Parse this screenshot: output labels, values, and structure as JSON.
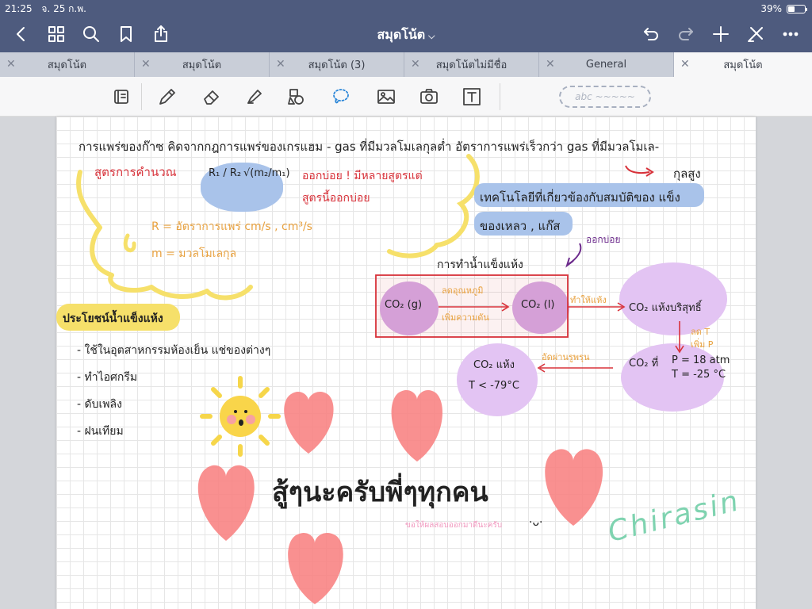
{
  "status": {
    "time": "21:25",
    "date": "จ. 25 ก.พ.",
    "battery_text": "39%",
    "battery_level": 0.39
  },
  "nav": {
    "title": "สมุดโน้ต",
    "icons": [
      "back-icon",
      "grid-icon",
      "search-icon",
      "bookmark-icon",
      "share-icon",
      "undo-icon",
      "redo-icon",
      "add-icon",
      "eraser-toggle-icon",
      "more-icon"
    ]
  },
  "tabs": [
    {
      "label": "สมุดโน้ต"
    },
    {
      "label": "สมุดโน้ต"
    },
    {
      "label": "สมุดโน้ต (3)"
    },
    {
      "label": "สมุดโน้ตไม่มีชื่อ"
    },
    {
      "label": "General"
    },
    {
      "label": "สมุดโน้ต",
      "active": true
    }
  ],
  "toolbar": {
    "tools": [
      "page-toggle-icon",
      "pen-icon",
      "eraser-icon",
      "highlighter-icon",
      "shapes-icon",
      "lasso-icon",
      "image-icon",
      "camera-icon",
      "text-icon"
    ],
    "pen_preview": "abc ~~~~~",
    "colors": {
      "bar": "#4e5b7e",
      "tabs": "#c9ced8"
    }
  },
  "note": {
    "line1": "การแพร่ของก๊าซ   คิดจากกฎการแพร่ของเกรแฮม - gas ที่มีมวลโมเลกุลต่ำ อัตราการแพร่เร็วกว่า gas ที่มีมวลโมเล-",
    "line1b": "กุลสูง",
    "formula_title": "สูตรการคำนวณ",
    "formula_left": "R₁ / R₂",
    "formula_right": "√(m₂/m₁)",
    "exam_note1": "ออกบ่อย ! มีหลายสูตรแต่",
    "exam_note2": "สูตรนี้ออกบ่อย",
    "def_r": "R =  อัตราการแพร่       cm/s ,  cm³/s",
    "def_m": "m =  มวลโมเลกุล",
    "tech1": "เทคโนโลยีที่เกี่ยวข้องกับสมบัติของ แข็ง",
    "tech2": "ของเหลว , แก๊ส",
    "often": "ออกบ่อย",
    "dryice_title": "การทำน้ำแข็งแห้ง",
    "co2g": "CO₂ (g)",
    "arrow1a": "ลดอุณหภูมิ",
    "arrow1b": "เพิ่มความดัน",
    "co2l": "CO₂ (l)",
    "make_dry": "ทำให้แห้ง",
    "co2pure": "CO₂ แห้งบริสุทธิ์",
    "reduce_t": "ลด T",
    "add_p": "เพิ่ม P",
    "co2at": "CO₂ ที่",
    "p_val": "P = 18 atm",
    "t_val": "T = -25 °C",
    "expand": "อัดผ่านรูพรุน",
    "co2dry": "CO₂ แห้ง",
    "tlow": "T < -79°C",
    "benefit_title": "ประโยชน์น้ำแข็งแห้ง",
    "benefits": [
      "- ใช้ในอุตสาหกรรมห้องเย็น แช่ของต่างๆ",
      "- ทำไอศกรีม",
      "- ดับเพลิง",
      "- ฝนเทียม"
    ],
    "cheer": "สู้ๆนะครับพี่ๆทุกคน",
    "small": "ขอให้ผลสอบออกมาดีนะครับ",
    "smiley": "·ᴗ·",
    "signature": "Chirasin"
  }
}
